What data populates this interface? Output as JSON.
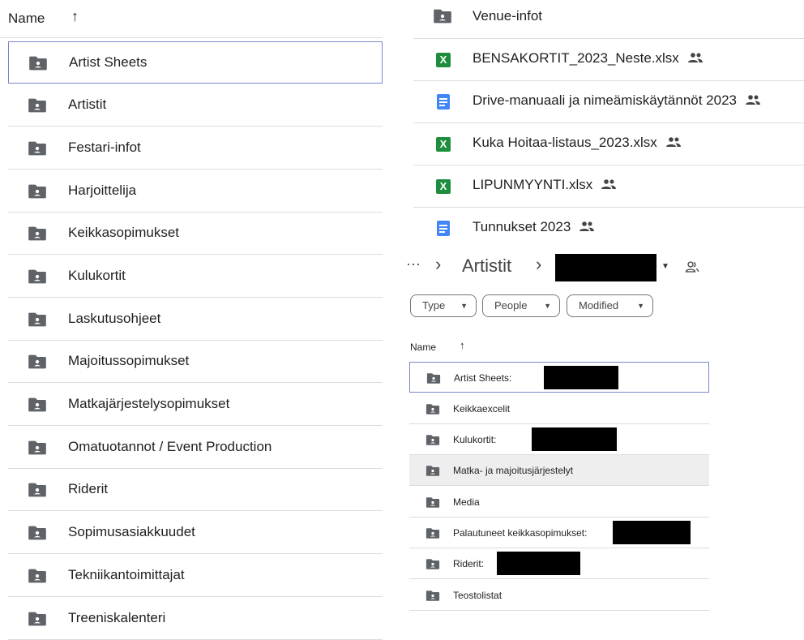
{
  "left_list": {
    "header": {
      "name_label": "Name",
      "sort_arrow": "↑"
    },
    "items": [
      {
        "label": "Artist Sheets",
        "icon": "shared-folder-icon",
        "selected": true
      },
      {
        "label": "Artistit",
        "icon": "shared-folder-icon"
      },
      {
        "label": "Festari-infot",
        "icon": "shared-folder-icon"
      },
      {
        "label": "Harjoittelija",
        "icon": "shared-folder-icon"
      },
      {
        "label": "Keikkasopimukset",
        "icon": "shared-folder-icon"
      },
      {
        "label": "Kulukortit",
        "icon": "shared-folder-icon"
      },
      {
        "label": "Laskutusohjeet",
        "icon": "shared-folder-icon"
      },
      {
        "label": "Majoitussopimukset",
        "icon": "shared-folder-icon"
      },
      {
        "label": "Matkajärjestelysopimukset",
        "icon": "shared-folder-icon"
      },
      {
        "label": "Omatuotannot / Event Production",
        "icon": "shared-folder-icon"
      },
      {
        "label": "Riderit",
        "icon": "shared-folder-icon"
      },
      {
        "label": "Sopimusasiakkuudet",
        "icon": "shared-folder-icon"
      },
      {
        "label": "Tekniikantoimittajat",
        "icon": "shared-folder-icon"
      },
      {
        "label": "Treeniskalenteri",
        "icon": "shared-folder-icon"
      }
    ]
  },
  "right_files": {
    "items": [
      {
        "label": "Venue-infot",
        "icon": "shared-folder-icon",
        "shared": false
      },
      {
        "label": "BENSAKORTIT_2023_Neste.xlsx",
        "icon": "excel-icon",
        "shared": true
      },
      {
        "label": "Drive-manuaali ja nimeämiskäytännöt 2023",
        "icon": "docs-icon",
        "shared": true
      },
      {
        "label": "Kuka Hoitaa-listaus_2023.xlsx",
        "icon": "excel-icon",
        "shared": true
      },
      {
        "label": "LIPUNMYYNTI.xlsx",
        "icon": "excel-icon",
        "shared": true
      },
      {
        "label": "Tunnukset 2023",
        "icon": "docs-icon",
        "shared": true
      }
    ]
  },
  "breadcrumb": {
    "more": "···",
    "sep": "›",
    "folder": "Artistit"
  },
  "filters": {
    "type": "Type",
    "people": "People",
    "modified": "Modified"
  },
  "sub_list": {
    "header": {
      "name_label": "Name",
      "sort_arrow": "↑"
    },
    "items": [
      {
        "label": "Artist Sheets:",
        "selected": true,
        "redacted": true
      },
      {
        "label": "Keikkaexcelit"
      },
      {
        "label": "Kulukortit:",
        "redacted": true
      },
      {
        "label": "Matka- ja majoitusjärjestelyt",
        "hover": true
      },
      {
        "label": "Media"
      },
      {
        "label": "Palautuneet keikkasopimukset:",
        "redacted": true
      },
      {
        "label": "Riderit:",
        "redacted": true
      },
      {
        "label": "Teostolistat"
      }
    ]
  },
  "colors": {
    "selected_border": "#7986cb",
    "excel": "#1e8e3e",
    "docs": "#4285f4",
    "folder": "#5f6368"
  }
}
